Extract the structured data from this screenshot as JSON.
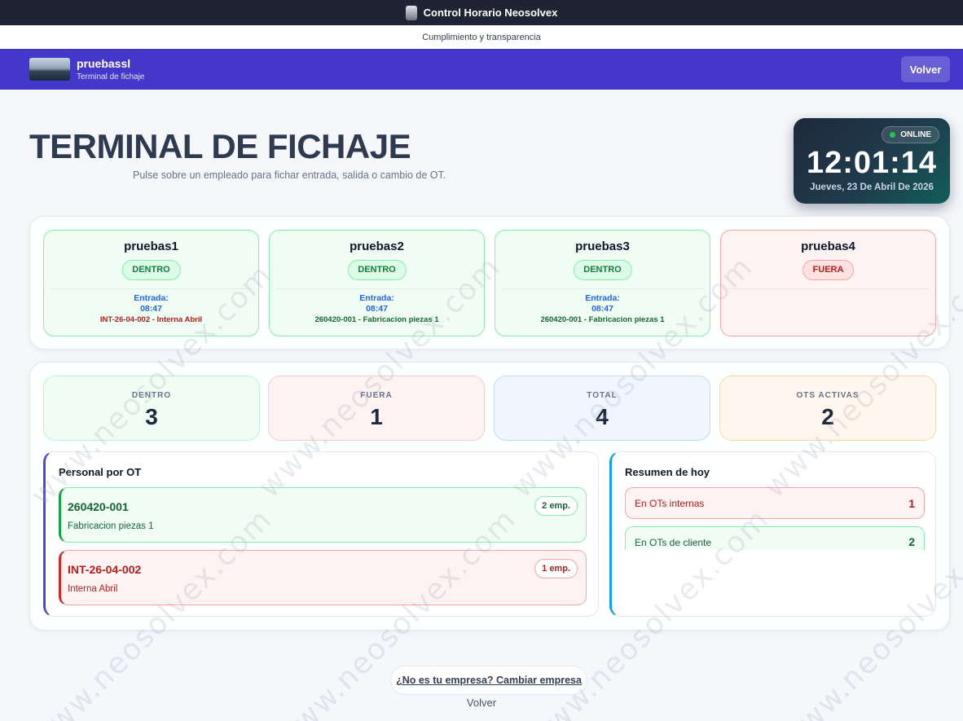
{
  "topbar": {
    "title": "Control Horario Neosolvex"
  },
  "subbar": {
    "text": "Cumplimiento y transparencia"
  },
  "header": {
    "company": "pruebassl",
    "subtitle": "Terminal de fichaje",
    "back_label": "Volver"
  },
  "main": {
    "title": "TERMINAL DE FICHAJE",
    "description": "Pulse sobre un empleado para fichar entrada, salida o cambio de OT."
  },
  "clock": {
    "status": "ONLINE",
    "time": "12:01:14",
    "date": "Jueves, 23 De Abril De 2026"
  },
  "employees": [
    {
      "name": "pruebas1",
      "status": "DENTRO",
      "entry_label": "Entrada:",
      "entry_time": "08:47",
      "ot": "INT-26-04-002 - Interna Abril"
    },
    {
      "name": "pruebas2",
      "status": "DENTRO",
      "entry_label": "Entrada:",
      "entry_time": "08:47",
      "ot": "260420-001 - Fabricacion piezas 1"
    },
    {
      "name": "pruebas3",
      "status": "DENTRO",
      "entry_label": "Entrada:",
      "entry_time": "08:47",
      "ot": "260420-001 - Fabricacion piezas 1"
    },
    {
      "name": "pruebas4",
      "status": "FUERA"
    }
  ],
  "stats": [
    {
      "label": "DENTRO",
      "value": "3"
    },
    {
      "label": "FUERA",
      "value": "1"
    },
    {
      "label": "TOTAL",
      "value": "4"
    },
    {
      "label": "OTS ACTIVAS",
      "value": "2"
    }
  ],
  "personal_por_ot": {
    "title": "Personal por OT",
    "items": [
      {
        "code": "260420-001",
        "description": "Fabricacion piezas 1",
        "count": "2 emp."
      },
      {
        "code": "INT-26-04-002",
        "description": "Interna Abril",
        "count": "1 emp."
      }
    ]
  },
  "resumen": {
    "title": "Resumen de hoy",
    "items": [
      {
        "label": "En OTs internas",
        "value": "1"
      },
      {
        "label": "En OTs de cliente",
        "value": "2"
      }
    ]
  },
  "footer": {
    "change_company": "¿No es tu empresa? Cambiar empresa",
    "back": "Volver"
  },
  "watermark": {
    "text": "www.neosolvex.com"
  },
  "colors": {
    "header": "#4338ca",
    "inside": "#15803d",
    "outside": "#b91c1c",
    "accent_blue": "#2563eb"
  }
}
